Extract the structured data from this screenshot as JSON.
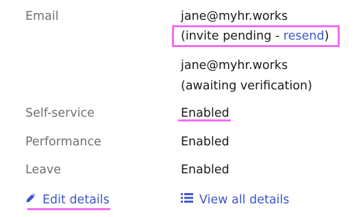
{
  "rows": {
    "email": {
      "label": "Email",
      "address_1": "jane@myhr.works",
      "pending_prefix": "(invite pending - ",
      "resend_label": "resend",
      "pending_suffix": ")",
      "address_2": "jane@myhr.works",
      "awaiting": "(awaiting verification)"
    },
    "self_service": {
      "label": "Self-service",
      "value": "Enabled"
    },
    "performance": {
      "label": "Performance",
      "value": "Enabled"
    },
    "leave": {
      "label": "Leave",
      "value": "Enabled"
    }
  },
  "actions": {
    "edit_details": {
      "label": "Edit details",
      "icon": "pencil-icon"
    },
    "view_all_details": {
      "label": "View all details",
      "icon": "list-icon"
    }
  },
  "colors": {
    "label": "#707070",
    "text": "#1a1a1a",
    "link": "#3b56c9",
    "highlight": "#f06cf0"
  }
}
